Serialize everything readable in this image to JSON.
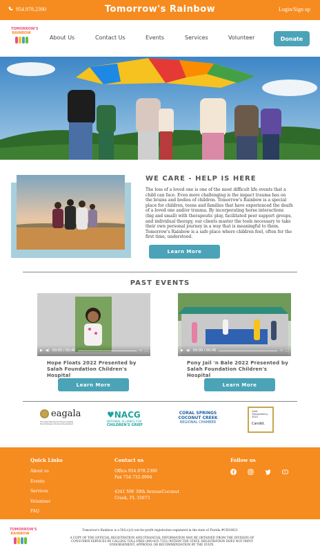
{
  "topbar": {
    "phone": "954.978.2390",
    "brand": "Tomorrow's Rainbow",
    "login": "Login/Sign up"
  },
  "logo": {
    "text": "TOMORROW'S RAINBOW"
  },
  "nav": {
    "items": [
      "About Us",
      "Contact Us",
      "Events",
      "Services",
      "Volunteer"
    ],
    "donate": "Donate"
  },
  "care": {
    "title": "WE CARE - HELP IS HERE",
    "body": "The loss of a loved one is one of the most difficult life events that a child can face. Even more challenging is the impact trauma has on the brains and bodies of children. Tomorrow's Rainbow is a special place for children, teens and families that have experienced the death of a loved one and/or trauma. By incorporating horse interactions (big and small) with therapeutic play, facilitated peer support groups, and individual therapy, our clients master the tools necessary to take their own personal journey in a way that is meaningful to them. Tomorrow's Rainbow is a safe place where children feel, often for the first time, understood.",
    "button": "Learn More"
  },
  "events": {
    "title": "PAST EVENTS",
    "items": [
      {
        "caption": "Hope Floats 2022 Presented by Salah Foundation Children's Hospital",
        "time": "00:00 / 00:40",
        "button": "Learn More"
      },
      {
        "caption": "Pony Jail 'n Bale 2022 Presented by Salah Foundation Children's Hospital",
        "time": "00:00 / 00:46",
        "button": "Learn More"
      }
    ]
  },
  "partners": {
    "eagala": {
      "name": "eagala",
      "sub": "The Global Standard for Equine Assisted Psychotherapy & Personal Development"
    },
    "nacg": {
      "name": "NACG",
      "sub1": "NATIONAL ALLIANCE FOR",
      "sub2": "CHILDREN'S GRIEF"
    },
    "coral": {
      "l1": "CORAL SPRINGS",
      "l2": "COCONUT CREEK",
      "l3": "REGIONAL CHAMBER"
    },
    "candid": {
      "l1": "Gold",
      "l2": "Transparency",
      "l3": "2022",
      "l4": "Candid."
    }
  },
  "footer": {
    "quick_title": "Quick Links",
    "quick_links": [
      "About us",
      "Events",
      "Services",
      "Volunteer",
      "FAQ"
    ],
    "contact_title": "Contact us",
    "office": "Office 954.978.2390",
    "fax": "Fax 754.732.0994",
    "address1": "4341 NW 39th AvenueCoconut",
    "address2": "Creek, FL 33073",
    "follow_title": "Follow us",
    "social_icons": [
      "facebook-icon",
      "instagram-icon",
      "twitter-icon",
      "youtube-icon"
    ]
  },
  "legal": {
    "note1": "Tomorrow's Rainbow is a 501(c)(3) not-for-profit registration registered in the state of Florida #CH18023",
    "note2": "A COPY OF THE OFFICIAL REGISTRATION AND FINANCIAL INFORMATION MAY BE OBTAINED FROM THE DIVISION OF CONSUMER SERVICES BY CALLING TOLL-FREE (800-435-7352) WITHIN THE STATE. REGISTRATION DOES NOT IMPLY ENDORSEMENT, APPROVAL OR RECOMMENDATION BY THE STATE."
  },
  "colors": {
    "orange": "#f68b1f",
    "teal": "#4ba3b8",
    "light_teal": "#a8d0dc"
  }
}
